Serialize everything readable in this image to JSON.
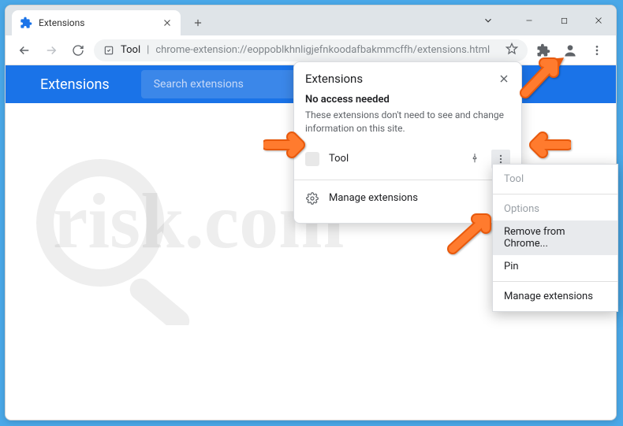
{
  "tab": {
    "title": "Extensions"
  },
  "address": {
    "prefix": "Tool",
    "url": "chrome-extension://eoppoblkhnligjefnkoodafbakmmcffh/extensions.html"
  },
  "page_header": {
    "title": "Extensions",
    "search_placeholder": "Search extensions"
  },
  "popup": {
    "title": "Extensions",
    "no_access_title": "No access needed",
    "no_access_desc": "These extensions don't need to see and change information on this site.",
    "extension_name": "Tool",
    "manage_label": "Manage extensions"
  },
  "context_menu": {
    "items": [
      {
        "label": "Tool",
        "state": "disabled"
      },
      {
        "label": "Options",
        "state": "disabled"
      },
      {
        "label": "Remove from Chrome...",
        "state": "selected"
      },
      {
        "label": "Pin",
        "state": "normal"
      }
    ],
    "manage": "Manage extensions"
  },
  "watermark_text": "risk.com"
}
